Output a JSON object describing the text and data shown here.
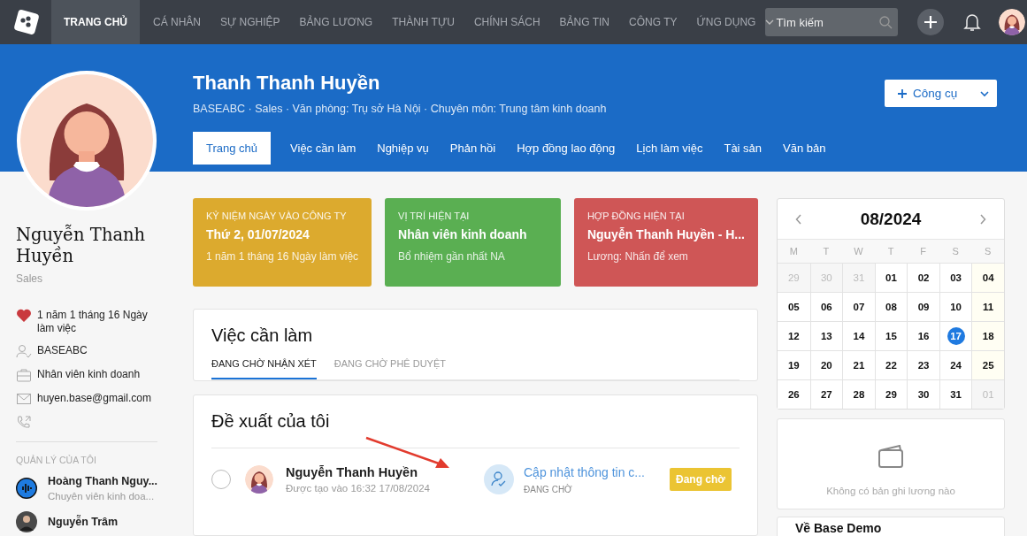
{
  "nav": {
    "items": [
      {
        "label": "TRANG CHỦ",
        "selected": true
      },
      {
        "label": "CÁ NHÂN",
        "selected": false
      },
      {
        "label": "SỰ NGHIỆP",
        "selected": false
      },
      {
        "label": "BẢNG LƯƠNG",
        "selected": false
      },
      {
        "label": "THÀNH TỰU",
        "selected": false
      },
      {
        "label": "CHÍNH SÁCH",
        "selected": false
      },
      {
        "label": "BẢNG TIN",
        "selected": false
      },
      {
        "label": "CÔNG TY",
        "selected": false
      },
      {
        "label": "ỨNG DỤNG",
        "selected": false
      }
    ],
    "search": {
      "placeholder": "Tìm kiếm"
    }
  },
  "profile": {
    "name": "Thanh Thanh Huyền",
    "subtitle": "BASEABC · Sales · Văn phòng: Trụ sở Hà Nội · Chuyên môn: Trung tâm kinh doanh",
    "tools_button": "Công cụ",
    "tabs": [
      {
        "label": "Trang chủ",
        "selected": true
      },
      {
        "label": "Việc cần làm",
        "selected": false
      },
      {
        "label": "Nghiệp vụ",
        "selected": false
      },
      {
        "label": "Phản hồi",
        "selected": false
      },
      {
        "label": "Hợp đồng lao động",
        "selected": false
      },
      {
        "label": "Lịch làm việc",
        "selected": false
      },
      {
        "label": "Tài sản",
        "selected": false
      },
      {
        "label": "Văn bản",
        "selected": false
      }
    ]
  },
  "sidebar": {
    "name": "Nguyễn Thanh Huyền",
    "department": "Sales",
    "info": [
      {
        "kind": "heart",
        "text": "1 năm 1 tháng 16 Ngày làm việc"
      },
      {
        "kind": "user",
        "text": "BASEABC"
      },
      {
        "kind": "briefcase",
        "text": "Nhân viên kinh doanh"
      },
      {
        "kind": "mail",
        "text": "huyen.base@gmail.com"
      },
      {
        "kind": "phone"
      }
    ],
    "managers_heading": "QUẢN LÝ CỦA TÔI",
    "managers": [
      {
        "kind": "logo",
        "name": "Hoàng Thanh Nguy...",
        "role": "Chuyên viên kinh doa..."
      },
      {
        "kind": "picture",
        "name": "Nguyễn Trâm"
      }
    ]
  },
  "cards": [
    {
      "heading": "KỶ NIỆM NGÀY VÀO CÔNG TY",
      "title": "Thứ 2, 01/07/2024",
      "note": "1 năm 1 tháng 16 Ngày làm việc",
      "color": "#dcaa2e"
    },
    {
      "heading": "VỊ TRÍ HIỆN TẠI",
      "title": "Nhân viên kinh doanh",
      "note": "Bổ nhiệm gần nhất NA",
      "color": "#5aaf52"
    },
    {
      "heading": "HỢP ĐỒNG HIỆN TẠI",
      "title": "Nguyễn Thanh Huyền - H...",
      "note": "Lương: Nhấn để xem",
      "color": "#cf5656"
    }
  ],
  "todo": {
    "title": "Việc cần làm",
    "tabs": [
      {
        "label": "ĐANG CHỜ NHẬN XÉT",
        "selected": true
      },
      {
        "label": "ĐANG CHỜ PHÊ DUYỆT",
        "selected": false
      }
    ]
  },
  "proposals": {
    "title": "Đề xuất của tôi",
    "items": [
      {
        "selected": false,
        "name": "Nguyễn Thanh Huyền",
        "created": "Được tạo vào 16:32 17/08/2024",
        "request": "Cập nhật thông tin c...",
        "status": "ĐANG CHỜ",
        "badge": "Đang chờ"
      }
    ]
  },
  "calendar": {
    "title": "08/2024",
    "weekdays": [
      "M",
      "T",
      "W",
      "T",
      "F",
      "S",
      "S"
    ],
    "weeks": [
      [
        {
          "day": "29",
          "muted": true,
          "selected": false
        },
        {
          "day": "30",
          "muted": true,
          "selected": false
        },
        {
          "day": "31",
          "muted": true,
          "selected": false
        },
        {
          "day": "01",
          "muted": false,
          "selected": false
        },
        {
          "day": "02",
          "muted": false,
          "selected": false
        },
        {
          "day": "03",
          "muted": false,
          "selected": false
        },
        {
          "day": "04",
          "muted": false,
          "selected": false
        }
      ],
      [
        {
          "day": "05",
          "muted": false,
          "selected": false
        },
        {
          "day": "06",
          "muted": false,
          "selected": false
        },
        {
          "day": "07",
          "muted": false,
          "selected": false
        },
        {
          "day": "08",
          "muted": false,
          "selected": false
        },
        {
          "day": "09",
          "muted": false,
          "selected": false
        },
        {
          "day": "10",
          "muted": false,
          "selected": false
        },
        {
          "day": "11",
          "muted": false,
          "selected": false
        }
      ],
      [
        {
          "day": "12",
          "muted": false,
          "selected": false
        },
        {
          "day": "13",
          "muted": false,
          "selected": false
        },
        {
          "day": "14",
          "muted": false,
          "selected": false
        },
        {
          "day": "15",
          "muted": false,
          "selected": false
        },
        {
          "day": "16",
          "muted": false,
          "selected": false
        },
        {
          "day": "17",
          "muted": false,
          "selected": true
        },
        {
          "day": "18",
          "muted": false,
          "selected": false
        }
      ],
      [
        {
          "day": "19",
          "muted": false,
          "selected": false
        },
        {
          "day": "20",
          "muted": false,
          "selected": false
        },
        {
          "day": "21",
          "muted": false,
          "selected": false
        },
        {
          "day": "22",
          "muted": false,
          "selected": false
        },
        {
          "day": "23",
          "muted": false,
          "selected": false
        },
        {
          "day": "24",
          "muted": false,
          "selected": false
        },
        {
          "day": "25",
          "muted": false,
          "selected": false
        }
      ],
      [
        {
          "day": "26",
          "muted": false,
          "selected": false
        },
        {
          "day": "27",
          "muted": false,
          "selected": false
        },
        {
          "day": "28",
          "muted": false,
          "selected": false
        },
        {
          "day": "29",
          "muted": false,
          "selected": false
        },
        {
          "day": "30",
          "muted": false,
          "selected": false
        },
        {
          "day": "31",
          "muted": false,
          "selected": false
        },
        {
          "day": "01",
          "muted": true,
          "selected": false
        }
      ]
    ]
  },
  "salary": {
    "empty_text": "Không có bản ghi lương nào"
  },
  "about": {
    "title": "Về Base Demo"
  }
}
